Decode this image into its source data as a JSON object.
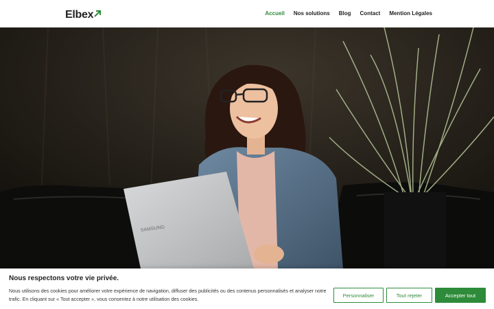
{
  "header": {
    "logo_text": "Elbex",
    "nav": [
      {
        "label": "Accueil",
        "active": true
      },
      {
        "label": "Nos solutions",
        "active": false
      },
      {
        "label": "Blog",
        "active": false
      },
      {
        "label": "Contact",
        "active": false
      },
      {
        "label": "Mention Légales",
        "active": false
      }
    ]
  },
  "hero": {
    "laptop_brand": "SAMSUNG"
  },
  "cookie": {
    "title": "Nous respectons votre vie privée.",
    "text": "Nous utilisons des cookies pour améliorer votre expérience de navigation, diffuser des publicités ou des contenus personnalisés et analyser notre trafic. En cliquant sur « Tout accepter », vous consentez à notre utilisation des cookies.",
    "customize_label": "Personnaliser",
    "reject_label": "Tout rejeter",
    "accept_label": "Accepter tout"
  },
  "colors": {
    "accent": "#2e8b3a",
    "active_nav": "#2e8b3a"
  }
}
